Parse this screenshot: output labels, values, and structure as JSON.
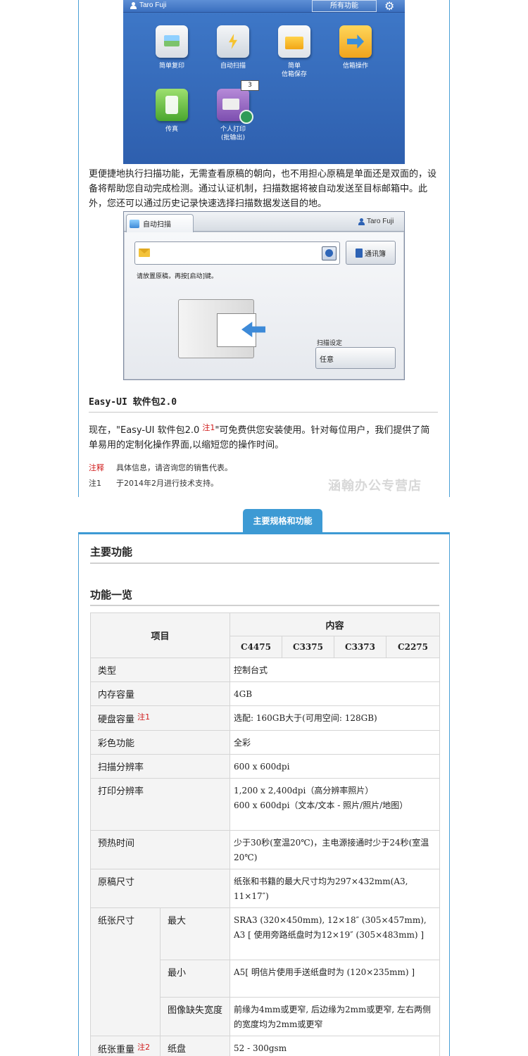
{
  "screen1": {
    "user": "Taro Fuji",
    "all_functions_label": "所有功能",
    "apps": [
      {
        "label": "简单复印",
        "icon": "copy-icon"
      },
      {
        "label": "自动扫描",
        "icon": "scan-icon"
      },
      {
        "label": "简单\n信箱保存",
        "icon": "mailbox-store-icon"
      },
      {
        "label": "信箱操作",
        "icon": "mailbox-operation-icon"
      },
      {
        "label": "传真",
        "icon": "fax-icon"
      },
      {
        "label": "个人打印\n(批输出)",
        "icon": "personal-print-icon"
      }
    ],
    "print_badge": "3",
    "colors": {
      "background": "#3f79c9",
      "bar": "#5d8fd6"
    }
  },
  "para1": "更便捷地执行扫描功能，无需查看原稿的朝向，也不用担心原稿是单面还是双面的，设备将帮助您自动完成检测。通过认证机制，扫描数据将被自动发送至目标邮箱中。此外，您还可以通过历史记录快速选择扫描数据发送目的地。",
  "screen2": {
    "tab_label": "自动扫描",
    "user": "Taro Fuji",
    "address_book_label": "通讯簿",
    "instruction": "请放置原稿，再按[启动]键。",
    "scan_settings_label": "扫描设定",
    "scan_settings_value": "任意"
  },
  "easy": {
    "title": "Easy-UI 软件包2.0",
    "para_before": "现在，\"Easy-UI 软件包2.0 ",
    "para_note": "注1",
    "para_after": "\"可免费供您安装使用。针对每位用户，我们提供了简单易用的定制化操作界面,以缩短您的操作时间。",
    "notes": [
      {
        "key": "注释",
        "text": "具体信息，请咨询您的销售代表。"
      },
      {
        "key": "注1",
        "text": "于2014年2月进行技术支持。"
      }
    ]
  },
  "watermark": "涵翰办公专营店",
  "section_tab": "主要规格和功能",
  "heading_main": "主要功能",
  "heading_sub": "功能一览",
  "table": {
    "head_item": "项目",
    "head_content": "内容",
    "models": [
      "C4475",
      "C3375",
      "C3373",
      "C2275"
    ],
    "rows": [
      {
        "label": "类型",
        "value": "控制台式"
      },
      {
        "label": "内存容量",
        "value": "4GB"
      },
      {
        "label": "硬盘容量",
        "note": "注1",
        "value": "选配: 160GB大于(可用空间: 128GB)"
      },
      {
        "label": "彩色功能",
        "value": "全彩"
      },
      {
        "label": "扫描分辨率",
        "value": "600 x 600dpi"
      },
      {
        "label": "打印分辨率",
        "value": "1,200 x 2,400dpi（高分辨率照片）\n600 x 600dpi（文本/文本 - 照片/照片/地图）"
      },
      {
        "label": "预热时间",
        "value": "少于30秒(室温20℃)，主电源接通时少于24秒(室温20℃)"
      },
      {
        "label": "原稿尺寸",
        "value": "纸张和书籍的最大尺寸均为297×432mm(A3, 11×17″)"
      }
    ],
    "paper_size": {
      "label": "纸张尺寸",
      "sub": [
        {
          "label": "最大",
          "value": "SRA3 (320×450mm), 12×18″ (305×457mm), A3 [ 使用旁路纸盘时为12×19″ (305×483mm) ]"
        },
        {
          "label": "最小",
          "value": "A5[ 明信片使用手送纸盘时为 (120×235mm) ]"
        },
        {
          "label": "图像缺失宽度",
          "value": "前缘为4mm或更窄, 后边缘为2mm或更窄, 左右两侧的宽度均为2mm或更窄"
        }
      ]
    },
    "paper_weight": {
      "label": "纸张重量",
      "note": "注2",
      "sub": [
        {
          "label": "纸盘",
          "value": "52 - 300gsm"
        }
      ]
    }
  }
}
